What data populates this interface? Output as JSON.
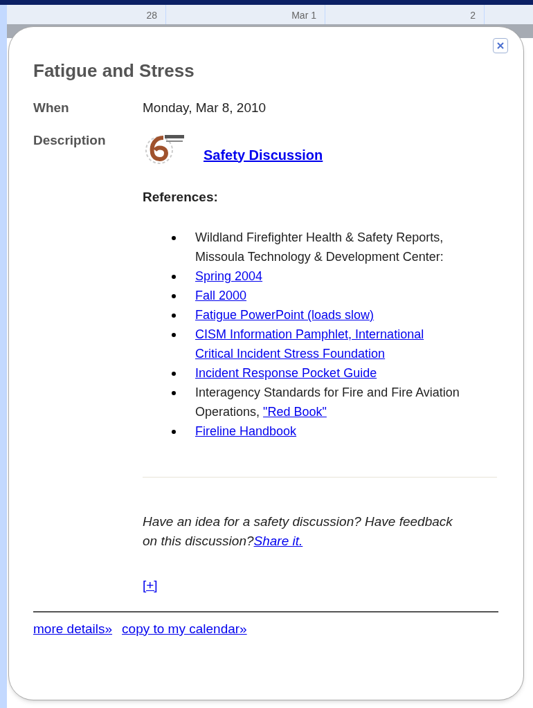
{
  "calendar_header": [
    "28",
    "Mar 1",
    "2"
  ],
  "popup": {
    "title": "Fatigue and Stress",
    "fields": [
      {
        "label": "When",
        "value": "Monday, Mar 8, 2010"
      }
    ],
    "description_label": "Description",
    "heading_link": "Safety Discussion",
    "references_title": "References:",
    "references": [
      {
        "parts": [
          {
            "kind": "text",
            "text": "Wildland Firefighter Health & Safety Reports, Missoula Technology & Development Center:"
          }
        ]
      },
      {
        "parts": [
          {
            "kind": "link",
            "text": "Spring 2004"
          }
        ]
      },
      {
        "parts": [
          {
            "kind": "link",
            "text": "Fall 2000"
          }
        ]
      },
      {
        "parts": [
          {
            "kind": "link",
            "text": "Fatigue PowerPoint (loads slow)"
          }
        ]
      },
      {
        "parts": [
          {
            "kind": "link",
            "text": "CISM Information Pamphlet, International Critical Incident Stress Foundation"
          }
        ]
      },
      {
        "parts": [
          {
            "kind": "link",
            "text": "Incident Response Pocket Guide"
          }
        ]
      },
      {
        "parts": [
          {
            "kind": "text",
            "text": "Interagency Standards for Fire and Fire Aviation Operations, "
          },
          {
            "kind": "link",
            "text": "\"Red Book\""
          }
        ]
      },
      {
        "parts": [
          {
            "kind": "link",
            "text": "Fireline Handbook"
          }
        ]
      }
    ],
    "feedback_text": "Have an idea for a safety discussion? Have feedback on this discussion?",
    "feedback_link": "Share it.",
    "expand_link": "[+]",
    "footer_links": [
      "more details»",
      "copy to my calendar»"
    ]
  }
}
